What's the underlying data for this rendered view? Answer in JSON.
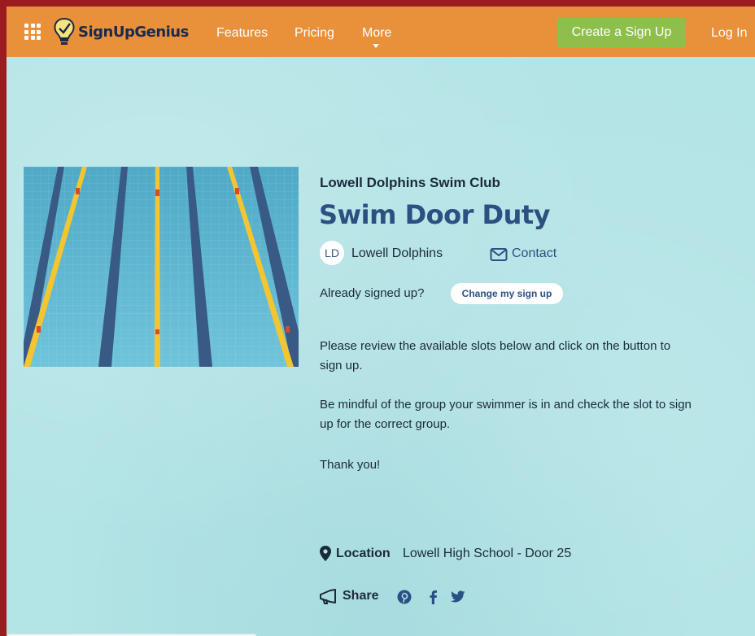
{
  "header": {
    "logo_text": "SignUpGenius",
    "nav": {
      "features": "Features",
      "pricing": "Pricing",
      "more": "More"
    },
    "create_button": "Create a Sign Up",
    "login": "Log In",
    "colors": {
      "bar": "#e8903a",
      "create": "#8ebf4b"
    }
  },
  "signup": {
    "organization": "Lowell Dolphins Swim Club",
    "title": "Swim Door Duty",
    "owner_initials": "LD",
    "owner_name": "Lowell Dolphins",
    "contact_label": "Contact",
    "already_signed_up": "Already signed up?",
    "change_button": "Change my sign up",
    "description": [
      "Please review the available slots below and click on the button to sign up.",
      "Be mindful of the group your swimmer is in and check the slot to sign up for the correct group.",
      "Thank you!"
    ],
    "location_label": "Location",
    "location_value": "Lowell High School - Door 25",
    "share_label": "Share",
    "share_icons": [
      "pinterest-icon",
      "facebook-icon",
      "twitter-icon"
    ]
  }
}
